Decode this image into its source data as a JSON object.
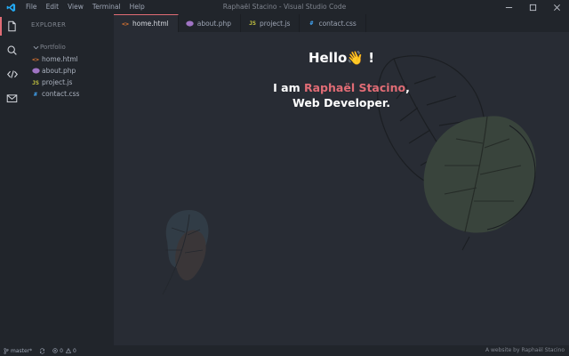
{
  "window": {
    "title": "Raphaël Stacino - Visual Studio Code",
    "logo": "vscode-logo-icon",
    "controls": [
      "minimize-icon",
      "maximize-icon",
      "close-icon"
    ]
  },
  "menu": [
    "File",
    "Edit",
    "View",
    "Terminal",
    "Help"
  ],
  "activitybar": {
    "items": [
      {
        "icon": "files-icon",
        "active": true
      },
      {
        "icon": "search-icon",
        "active": false
      },
      {
        "icon": "code-icon",
        "active": false
      },
      {
        "icon": "mail-icon",
        "active": false
      }
    ]
  },
  "sidebar": {
    "title": "EXPLORER",
    "folder": "Portfolio",
    "files": [
      {
        "name": "home.html",
        "icon": "<>",
        "icon_color": "#e37933"
      },
      {
        "name": "about.php",
        "icon": "php",
        "icon_color": "#a074c4"
      },
      {
        "name": "project.js",
        "icon": "JS",
        "icon_color": "#cbcb41"
      },
      {
        "name": "contact.css",
        "icon": "#",
        "icon_color": "#42a5f5"
      }
    ]
  },
  "tabs": [
    {
      "label": "home.html",
      "icon": "<>",
      "icon_color": "#e37933",
      "active": true
    },
    {
      "label": "about.php",
      "icon": "php",
      "icon_color": "#a074c4",
      "active": false
    },
    {
      "label": "project.js",
      "icon": "JS",
      "icon_color": "#cbcb41",
      "active": false
    },
    {
      "label": "contact.css",
      "icon": "#",
      "icon_color": "#42a5f5",
      "active": false
    }
  ],
  "editor": {
    "greeting": "Hello",
    "greeting_emoji": "👋",
    "greeting_end": " !",
    "intro_prefix": "I am ",
    "name": "Raphaël Stacino",
    "intro_suffix": ",",
    "role": "Web Developer."
  },
  "statusbar": {
    "branch": "master*",
    "errors": "0",
    "warnings": "0",
    "credit": "A website by Raphaël Stacino"
  },
  "colors": {
    "accent": "#e06c75",
    "background": "#282c34",
    "sidebar": "#21252b"
  }
}
